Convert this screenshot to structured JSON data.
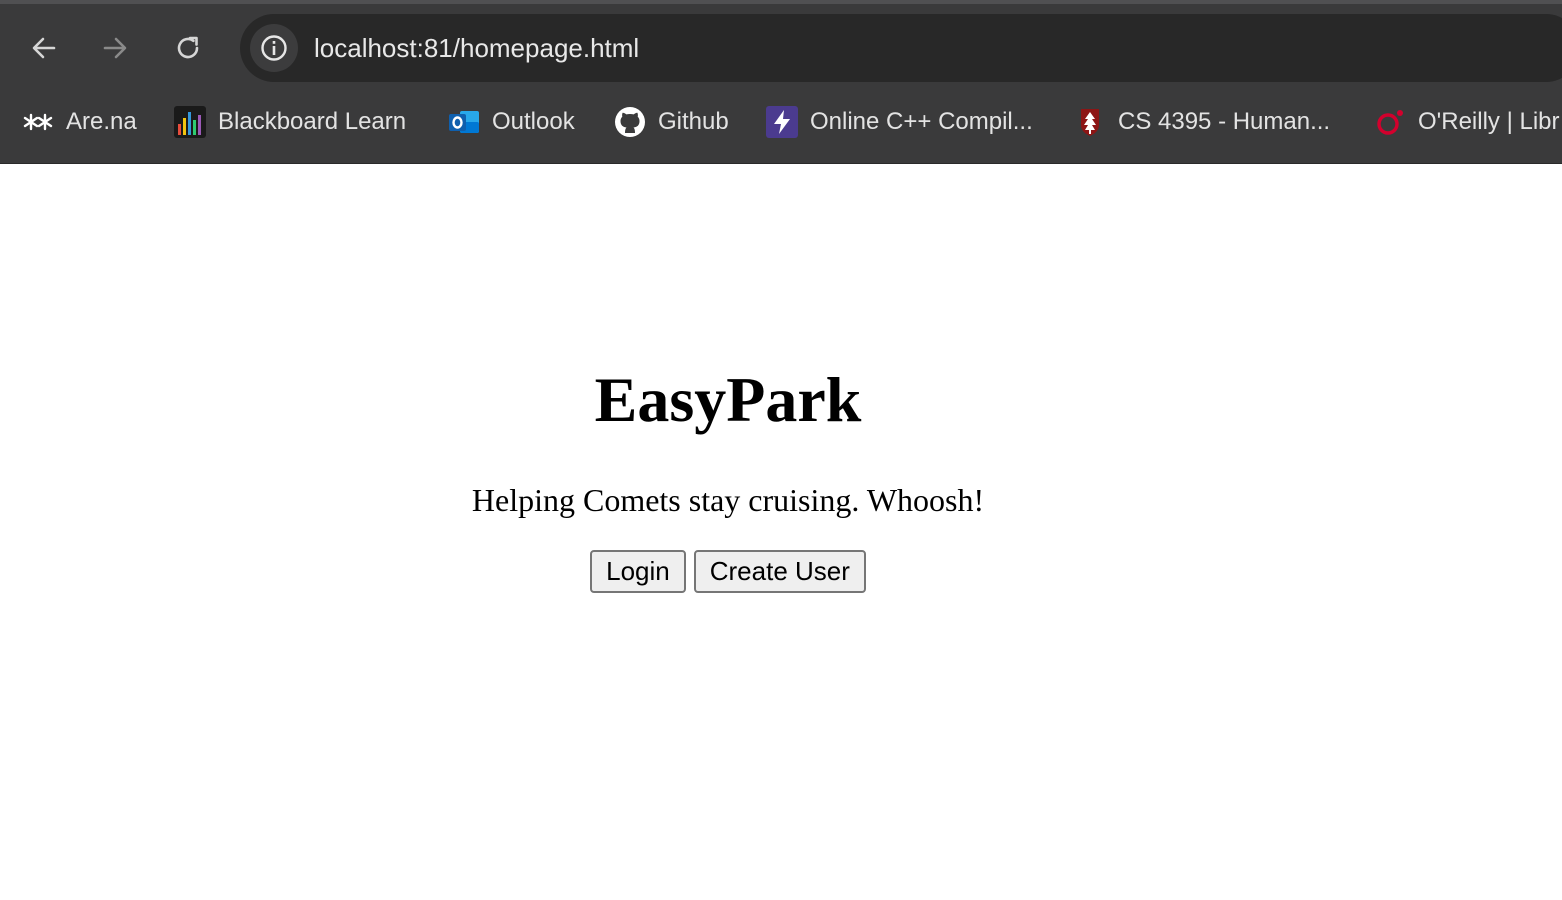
{
  "browser": {
    "url": "localhost:81/homepage.html",
    "nav": {
      "back_icon": "arrow-left-icon",
      "forward_icon": "arrow-right-icon",
      "reload_icon": "reload-icon",
      "site_info_icon": "info-icon"
    },
    "bookmarks": [
      {
        "label": "Are.na",
        "icon": "arena-icon"
      },
      {
        "label": "Blackboard Learn",
        "icon": "blackboard-icon"
      },
      {
        "label": "Outlook",
        "icon": "outlook-icon"
      },
      {
        "label": "Github",
        "icon": "github-icon"
      },
      {
        "label": "Online C++ Compil...",
        "icon": "bolt-icon"
      },
      {
        "label": "CS 4395 - Human...",
        "icon": "stanford-tree-icon"
      },
      {
        "label": "O'Reilly | Libr",
        "icon": "oreilly-icon"
      }
    ]
  },
  "page": {
    "title": "EasyPark",
    "tagline": "Helping Comets stay cruising. Whoosh!",
    "buttons": {
      "login": "Login",
      "create_user": "Create User"
    }
  }
}
